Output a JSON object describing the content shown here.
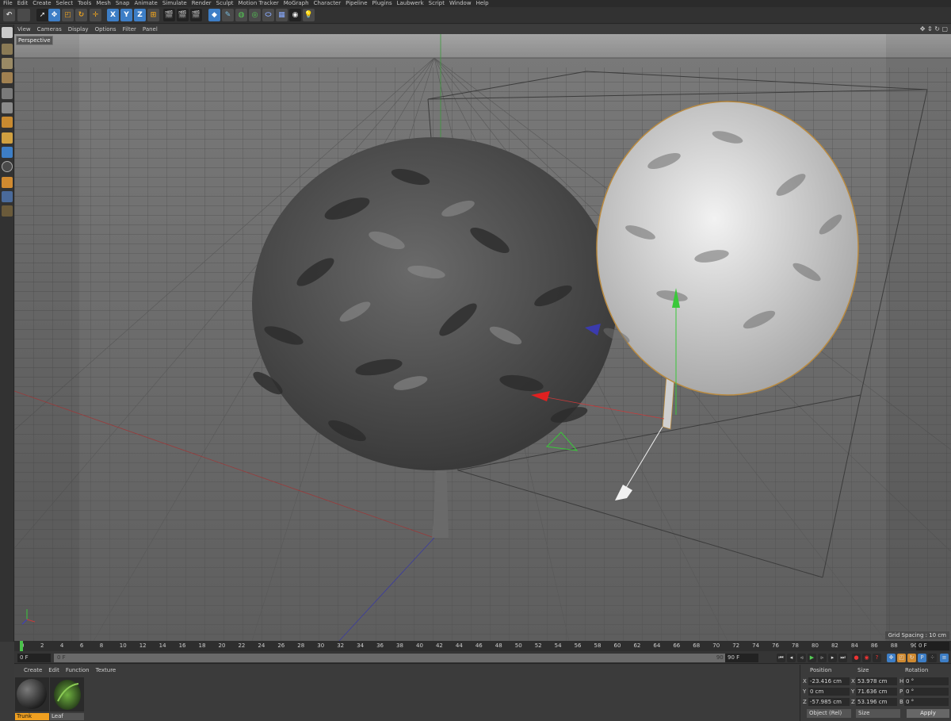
{
  "menubar": [
    "File",
    "Edit",
    "Create",
    "Select",
    "Tools",
    "Mesh",
    "Snap",
    "Animate",
    "Simulate",
    "Render",
    "Sculpt",
    "Motion Tracker",
    "MoGraph",
    "Character",
    "Pipeline",
    "Plugins",
    "Laubwerk",
    "Script",
    "Window",
    "Help"
  ],
  "toolbar": {
    "x_label": "X",
    "y_label": "Y",
    "z_label": "Z"
  },
  "viewport_menu": [
    "View",
    "Cameras",
    "Display",
    "Options",
    "Filter",
    "Panel"
  ],
  "viewport": {
    "label": "Perspective",
    "grid_spacing": "Grid Spacing : 10 cm"
  },
  "timeline": {
    "ticks": [
      "0",
      "2",
      "4",
      "6",
      "8",
      "10",
      "12",
      "14",
      "16",
      "18",
      "20",
      "22",
      "24",
      "26",
      "28",
      "30",
      "32",
      "34",
      "36",
      "38",
      "40",
      "42",
      "44",
      "46",
      "48",
      "50",
      "52",
      "54",
      "56",
      "58",
      "60",
      "62",
      "64",
      "66",
      "68",
      "70",
      "72",
      "74",
      "76",
      "78",
      "80",
      "82",
      "84",
      "86",
      "88",
      "9C"
    ],
    "end_field": "0 F",
    "current_frame": "0 F",
    "range_start": "0 F",
    "range_end": "90 F",
    "max_frame": "90 F"
  },
  "material_manager": {
    "menu": [
      "Create",
      "Edit",
      "Function",
      "Texture"
    ],
    "materials": [
      {
        "name": "Trunk",
        "selected": true
      },
      {
        "name": "Leaf",
        "selected": false
      }
    ]
  },
  "coordinates": {
    "headers": {
      "position": "Position",
      "size": "Size",
      "rotation": "Rotation"
    },
    "rows": [
      {
        "axis": "X",
        "position": "-23.416 cm",
        "size_axis": "X",
        "size": "53.978 cm",
        "rot_axis": "H",
        "rotation": "0 °"
      },
      {
        "axis": "Y",
        "position": "0 cm",
        "size_axis": "Y",
        "size": "71.636 cm",
        "rot_axis": "P",
        "rotation": "0 °"
      },
      {
        "axis": "Z",
        "position": "-57.985 cm",
        "size_axis": "Z",
        "size": "53.196 cm",
        "rot_axis": "B",
        "rotation": "0 °"
      }
    ],
    "mode_dropdown": "Object (Rel)",
    "size_dropdown": "Size",
    "apply": "Apply"
  },
  "colors": {
    "accent": "#3d7ec6",
    "playhead": "#49c249",
    "selection": "#f0a020"
  }
}
